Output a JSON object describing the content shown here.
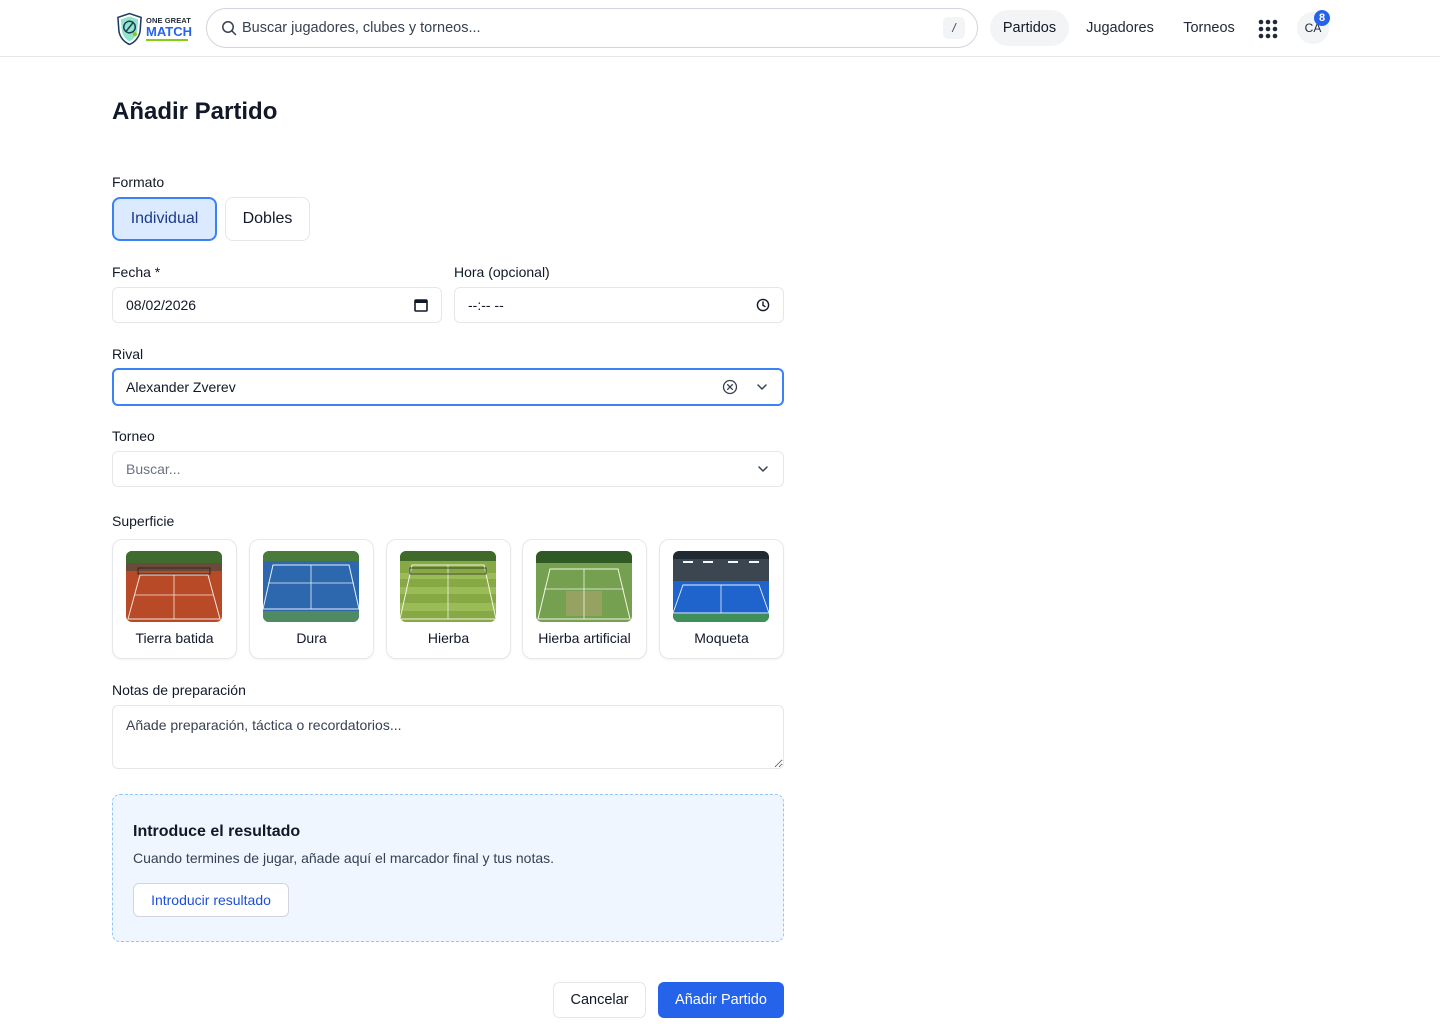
{
  "header": {
    "logo": {
      "line1": "ONE GREAT",
      "line2": "MATCH"
    },
    "search": {
      "placeholder": "Buscar jugadores, clubes y torneos...",
      "shortcut": "/"
    },
    "nav": [
      {
        "label": "Partidos",
        "active": true
      },
      {
        "label": "Jugadores",
        "active": false
      },
      {
        "label": "Torneos",
        "active": false
      }
    ],
    "apps_icon": "grid-dots-icon",
    "avatar": {
      "initials": "CA",
      "notifications": "8"
    }
  },
  "form": {
    "title": "Añadir Partido",
    "format": {
      "label": "Formato",
      "options": [
        {
          "label": "Individual",
          "selected": true
        },
        {
          "label": "Dobles",
          "selected": false
        }
      ]
    },
    "date": {
      "label": "Fecha *",
      "value": "08/02/2026"
    },
    "time": {
      "label": "Hora (opcional)",
      "value": "--:-- --"
    },
    "rival": {
      "label": "Rival",
      "value": "Alexander Zverev"
    },
    "tournament": {
      "label": "Torneo",
      "placeholder": "Buscar..."
    },
    "surface": {
      "label": "Superficie",
      "options": [
        {
          "label": "Tierra batida"
        },
        {
          "label": "Dura"
        },
        {
          "label": "Hierba"
        },
        {
          "label": "Hierba artificial"
        },
        {
          "label": "Moqueta"
        }
      ]
    },
    "notes": {
      "label": "Notas de preparación",
      "placeholder": "Añade preparación, táctica o recordatorios..."
    },
    "result": {
      "title": "Introduce el resultado",
      "description": "Cuando termines de jugar, añade aquí el marcador final y tus notas.",
      "button": "Introducir resultado"
    },
    "actions": {
      "cancel": "Cancelar",
      "submit": "Añadir Partido"
    }
  },
  "colors": {
    "accent": "#2563eb",
    "clay": "#c0532c",
    "hard": "#2f6fb5",
    "grass": "#7fa33e",
    "artificial_grass": "#6f9a4b",
    "carpet": "#1f62c9"
  }
}
